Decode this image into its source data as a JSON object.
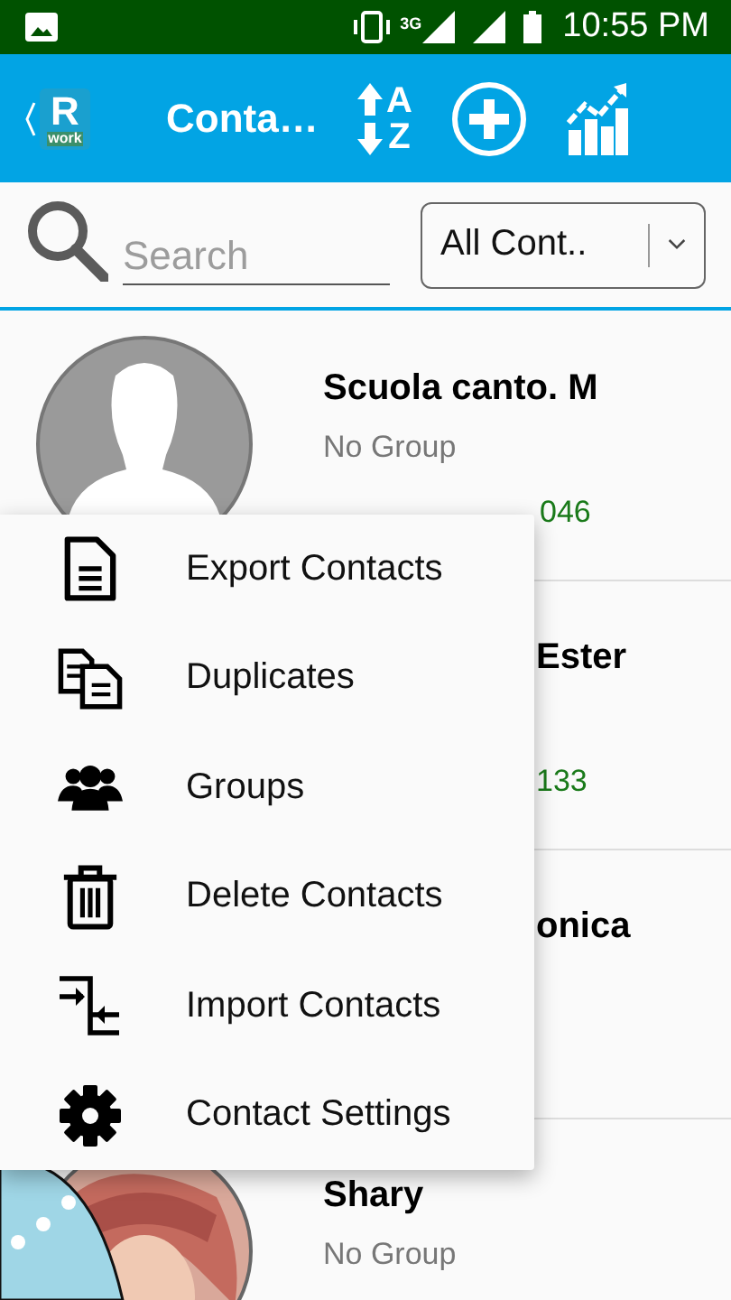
{
  "status_bar": {
    "network": "3G",
    "time": "10:55 PM"
  },
  "app_bar": {
    "logo_letter": "R",
    "logo_word": "work",
    "title": "Conta…",
    "sort_letters": [
      "A",
      "Z"
    ]
  },
  "search": {
    "placeholder": "Search"
  },
  "filter": {
    "value": "All Cont.."
  },
  "contacts": [
    {
      "kind": "full",
      "name": "Scuola canto. M",
      "group": "No Group",
      "phone": "046",
      "avatar": {
        "kind": "placeholder"
      }
    },
    {
      "kind": "covered",
      "name": "Ester",
      "phone": "133"
    },
    {
      "kind": "covered",
      "name": "onica"
    },
    {
      "kind": "full",
      "name": "Shary",
      "group": "No Group"
    }
  ],
  "menu": {
    "items": [
      {
        "kind": "export",
        "label": "Export Contacts"
      },
      {
        "kind": "duplicates",
        "label": "Duplicates"
      },
      {
        "kind": "groups",
        "label": "Groups"
      },
      {
        "kind": "delete",
        "label": "Delete Contacts"
      },
      {
        "kind": "import",
        "label": "Import Contacts"
      },
      {
        "kind": "settings",
        "label": "Contact Settings"
      }
    ]
  }
}
